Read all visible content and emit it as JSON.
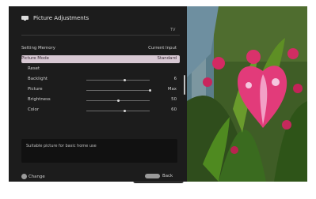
{
  "menu": {
    "title": "Picture Adjustments",
    "source_tag": "TV",
    "description": "Suitable picture for basic home use",
    "items": [
      {
        "label": "Setting Memory",
        "value": "Current Input"
      },
      {
        "label": "Picture Mode",
        "value": "Standard"
      },
      {
        "label": "Reset",
        "value": ""
      },
      {
        "label": "Backlight",
        "value": "6",
        "level": 0.6
      },
      {
        "label": "Picture",
        "value": "Max",
        "level": 1.0
      },
      {
        "label": "Brightness",
        "value": "50",
        "level": 0.5
      },
      {
        "label": "Color",
        "value": "60",
        "level": 0.6
      }
    ]
  },
  "footer": {
    "change_label": "Change",
    "back_label": "Back"
  },
  "icons": {
    "header": "tv-icon",
    "change": "circle-button-icon",
    "back": "return-button-icon"
  },
  "colors": {
    "panel_bg": "#1c1c1c",
    "highlight": "#d7c8d3"
  }
}
